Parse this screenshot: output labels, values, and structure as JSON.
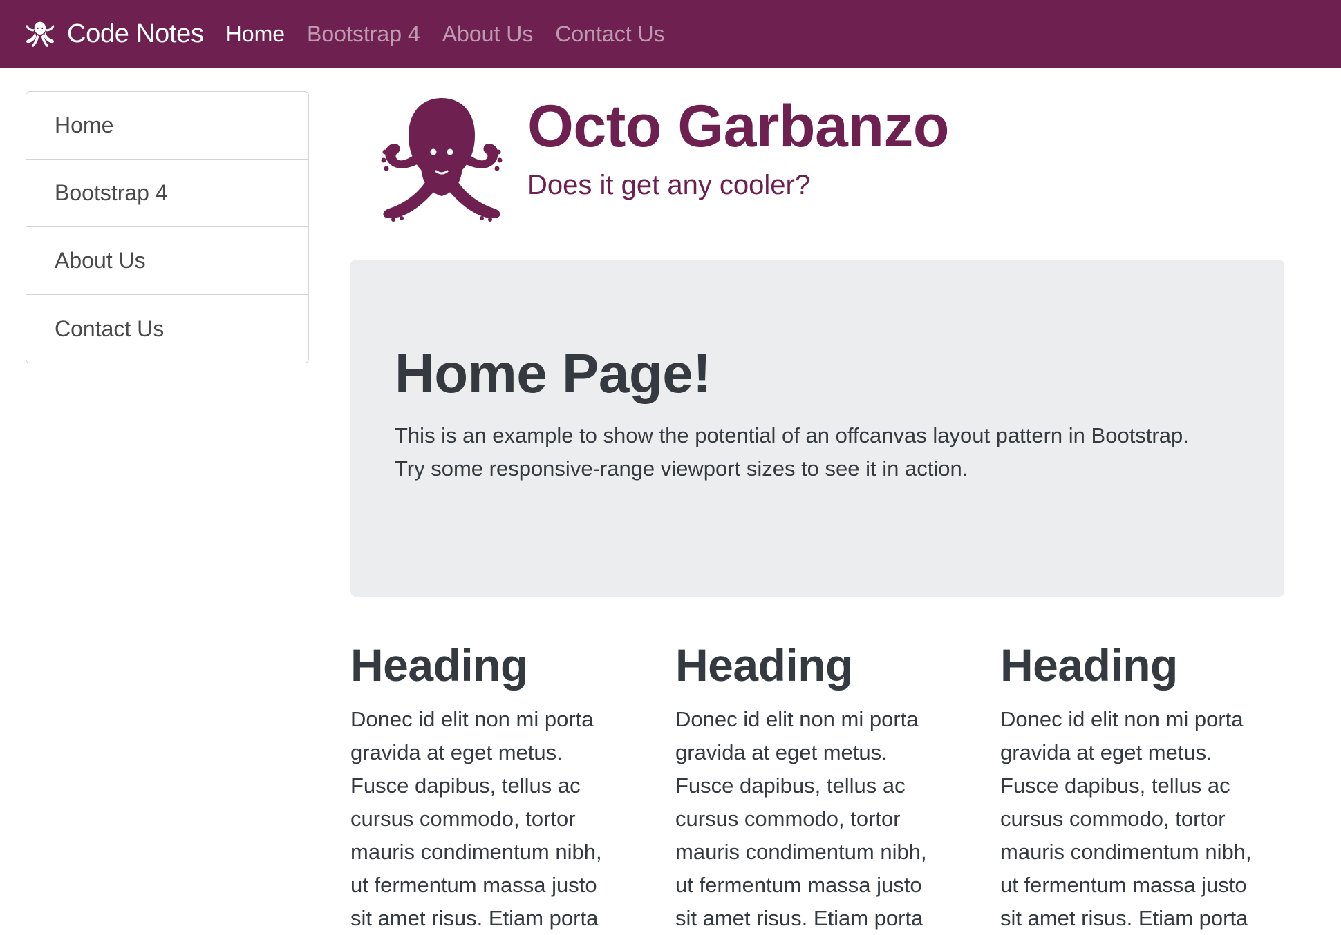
{
  "colors": {
    "brand": "#6e2150",
    "jumbotron_bg": "#ecedee",
    "text": "#343a40"
  },
  "navbar": {
    "brand_icon": "octopus-icon",
    "brand_text": "Code Notes",
    "links": [
      {
        "label": "Home",
        "active": true
      },
      {
        "label": "Bootstrap 4",
        "active": false
      },
      {
        "label": "About Us",
        "active": false
      },
      {
        "label": "Contact Us",
        "active": false
      }
    ]
  },
  "sidebar": {
    "items": [
      {
        "label": "Home"
      },
      {
        "label": "Bootstrap 4"
      },
      {
        "label": "About Us"
      },
      {
        "label": "Contact Us"
      }
    ]
  },
  "header": {
    "logo_icon": "octopus-icon",
    "title": "Octo Garbanzo",
    "subtitle": "Does it get any cooler?"
  },
  "jumbotron": {
    "title": "Home Page!",
    "text_line1": "This is an example to show the potential of an offcanvas layout pattern in Bootstrap.",
    "text_line2": "Try some responsive-range viewport sizes to see it in action."
  },
  "columns": [
    {
      "heading": "Heading",
      "text": "Donec id elit non mi porta gravida at eget metus. Fusce dapibus, tellus ac cursus commodo, tortor mauris condimentum nibh, ut fermentum massa justo sit amet risus. Etiam porta"
    },
    {
      "heading": "Heading",
      "text": "Donec id elit non mi porta gravida at eget metus. Fusce dapibus, tellus ac cursus commodo, tortor mauris condimentum nibh, ut fermentum massa justo sit amet risus. Etiam porta"
    },
    {
      "heading": "Heading",
      "text": "Donec id elit non mi porta gravida at eget metus. Fusce dapibus, tellus ac cursus commodo, tortor mauris condimentum nibh, ut fermentum massa justo sit amet risus. Etiam porta"
    }
  ]
}
